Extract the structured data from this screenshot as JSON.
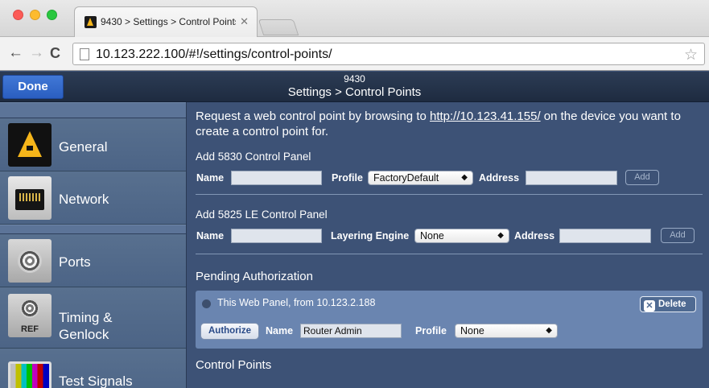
{
  "browser": {
    "tab_title": "9430 > Settings > Control Points",
    "url": "10.123.222.100/#!/settings/control-points/"
  },
  "header": {
    "done_label": "Done",
    "subtitle": "9430",
    "title": "Settings > Control Points"
  },
  "sidebar": {
    "items": [
      {
        "label": "General",
        "icon": "general-icon"
      },
      {
        "label": "Network",
        "icon": "network-icon"
      },
      {
        "label": "Ports",
        "icon": "ports-icon"
      },
      {
        "label": "Timing &\nGenlock",
        "icon": "timing-icon",
        "icon_text": "REF"
      },
      {
        "label": "Test Signals",
        "icon": "test-signals-icon"
      }
    ]
  },
  "intro": {
    "before": "Request a web control point by browsing to ",
    "link": "http://10.123.41.155/",
    "after": " on the device you want to create a control point for."
  },
  "panel_5830": {
    "title": "Add 5830 Control Panel",
    "name_label": "Name",
    "name_value": "",
    "profile_label": "Profile",
    "profile_value": "FactoryDefault",
    "address_label": "Address",
    "address_value": "",
    "add_label": "Add"
  },
  "panel_5825": {
    "title": "Add 5825 LE Control Panel",
    "name_label": "Name",
    "name_value": "",
    "engine_label": "Layering Engine",
    "engine_value": "None",
    "address_label": "Address",
    "address_value": "",
    "add_label": "Add"
  },
  "pending": {
    "title": "Pending Authorization",
    "item_text": "This Web Panel, from 10.123.2.188",
    "delete_label": "Delete",
    "authorize_label": "Authorize",
    "name_label": "Name",
    "name_value": "Router Admin",
    "profile_label": "Profile",
    "profile_value": "None"
  },
  "control_points": {
    "title": "Control Points"
  },
  "colors": {
    "content_bg": "#3d5276",
    "pending_card": "#6a85b0",
    "done_button": "#2e66c8"
  }
}
